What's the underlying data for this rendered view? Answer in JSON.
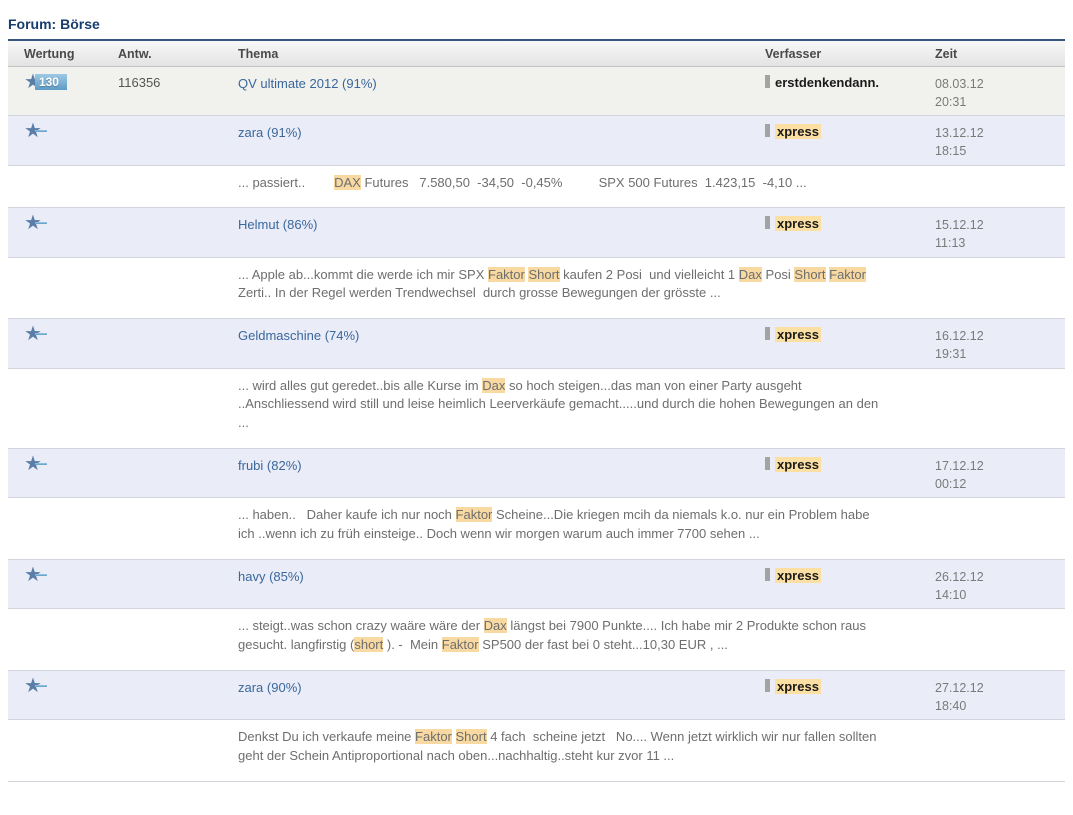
{
  "page": {
    "title": "Forum: Börse"
  },
  "colors": {
    "title": "#173d6d",
    "topic_link": "#3a679c",
    "term_highlight": "#f8d9a1",
    "author_highlight": "#fbdfa3",
    "rating_badge_blue": "#5e9bc6",
    "row_alt_background": "#eaecf8"
  },
  "table": {
    "headers": {
      "wertung": "Wertung",
      "antw": "Antw.",
      "thema": "Thema",
      "verfasser": "Verfasser",
      "zeit": "Zeit"
    },
    "threads": [
      {
        "rating_badge": "130",
        "rating_icon": "star-icon",
        "answers": "116356",
        "topic": "QV ultimate 2012 (91%)",
        "author": "erstdenkendann.",
        "author_highlight": false,
        "date": "08.03.12",
        "time": "20:31",
        "row_style": "first",
        "snippet": null
      },
      {
        "rating_badge": null,
        "answers": "",
        "topic": "zara (91%)",
        "author": "xpress",
        "author_highlight": true,
        "date": "13.12.12",
        "time": "18:15",
        "row_style": "alt",
        "snippet": [
          {
            "t": "... passiert..        "
          },
          {
            "t": "DAX",
            "h": true
          },
          {
            "t": " Futures   7.580,50  -34,50  -0,45%          SPX 500 Futures  1.423,15  -4,10 ..."
          }
        ]
      },
      {
        "rating_badge": null,
        "answers": "",
        "topic": "Helmut (86%)",
        "author": "xpress",
        "author_highlight": true,
        "date": "15.12.12",
        "time": "11:13",
        "row_style": "alt",
        "snippet": [
          {
            "t": "... Apple ab...kommt die werde ich mir SPX "
          },
          {
            "t": "Faktor",
            "h": true
          },
          {
            "t": " "
          },
          {
            "t": "Short",
            "h": true
          },
          {
            "t": " kaufen 2 Posi  und vielleicht 1 "
          },
          {
            "t": "Dax",
            "h": true
          },
          {
            "t": " Posi "
          },
          {
            "t": "Short",
            "h": true
          },
          {
            "t": " "
          },
          {
            "t": "Faktor",
            "h": true
          },
          {
            "t": " Zerti.. In der Regel werden Trendwechsel  durch grosse Bewegungen der grösste ..."
          }
        ]
      },
      {
        "rating_badge": null,
        "answers": "",
        "topic": "Geldmaschine (74%)",
        "author": "xpress",
        "author_highlight": true,
        "date": "16.12.12",
        "time": "19:31",
        "row_style": "alt",
        "snippet": [
          {
            "t": "... wird alles gut geredet..bis alle Kurse im "
          },
          {
            "t": "Dax",
            "h": true
          },
          {
            "t": " so hoch steigen...das man von einer Party ausgeht ..Anschliessend wird still und leise heimlich Leerverkäufe gemacht.....und durch die hohen Bewegungen an den ..."
          }
        ]
      },
      {
        "rating_badge": null,
        "answers": "",
        "topic": "frubi (82%)",
        "author": "xpress",
        "author_highlight": true,
        "date": "17.12.12",
        "time": "00:12",
        "row_style": "alt",
        "snippet": [
          {
            "t": "... haben..   Daher kaufe ich nur noch "
          },
          {
            "t": "Faktor",
            "h": true
          },
          {
            "t": " Scheine...Die kriegen mcih da niemals k.o. nur ein Problem habe ich ..wenn ich zu früh einsteige.. Doch wenn wir morgen warum auch immer 7700 sehen ..."
          }
        ]
      },
      {
        "rating_badge": null,
        "answers": "",
        "topic": "havy (85%)",
        "author": "xpress",
        "author_highlight": true,
        "date": "26.12.12",
        "time": "14:10",
        "row_style": "alt",
        "snippet": [
          {
            "t": "... steigt..was schon crazy waäre wäre der "
          },
          {
            "t": "Dax",
            "h": true
          },
          {
            "t": " längst bei 7900 Punkte.... Ich habe mir 2 Produkte schon raus gesucht. langfirstig ("
          },
          {
            "t": "short",
            "h": true
          },
          {
            "t": " ). -  Mein "
          },
          {
            "t": "Faktor",
            "h": true
          },
          {
            "t": " SP500 der fast bei 0 steht...10,30 EUR , ..."
          }
        ]
      },
      {
        "rating_badge": null,
        "answers": "",
        "topic": "zara (90%)",
        "author": "xpress",
        "author_highlight": true,
        "date": "27.12.12",
        "time": "18:40",
        "row_style": "alt",
        "snippet": [
          {
            "t": "Denkst Du ich verkaufe meine "
          },
          {
            "t": "Faktor",
            "h": true
          },
          {
            "t": " "
          },
          {
            "t": "Short",
            "h": true
          },
          {
            "t": " 4 fach  scheine jetzt   No.... Wenn jetzt wirklich wir nur fallen sollten geht der Schein Antiproportional nach oben...nachhaltig..steht kur zvor 11 ..."
          }
        ]
      }
    ]
  }
}
